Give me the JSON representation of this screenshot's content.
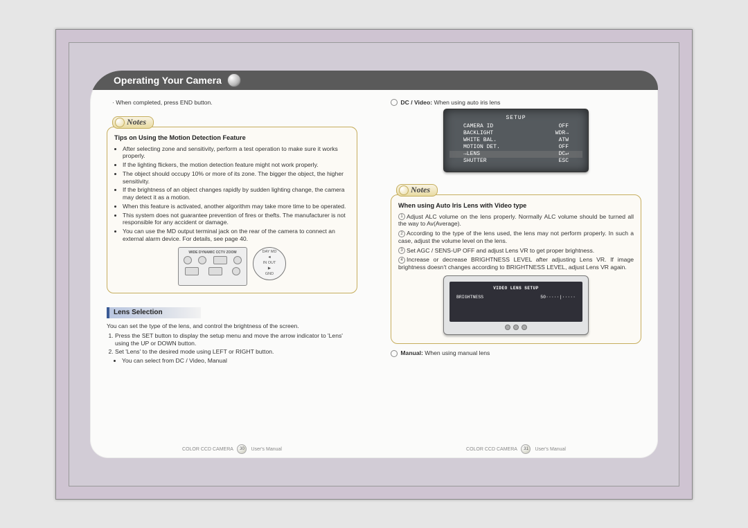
{
  "header": {
    "title": "Operating Your Camera"
  },
  "left": {
    "top_line": "· When completed, press END button.",
    "notes": {
      "label": "Notes",
      "title": "Tips on Using the Motion Detection Feature",
      "items": [
        "After selecting zone and sensitivity, perform a test operation to make sure it works properly.",
        "If the lighting flickers, the motion detection feature might not work properly.",
        "The object should occupy 10% or more of its zone. The bigger the object, the higher sensitivity.",
        "If the brightness of an object changes rapidly by sudden lighting change, the camera may detect it as a motion.",
        "When this feature is activated, another algorithm may take more time to be operated.",
        "This system does not guarantee prevention of fires or thefts. The manufacturer is not responsible for any accident or damage.",
        "You can use the MD output terminal jack on the rear of the camera to connect an external alarm device. For details, see page 40."
      ],
      "panel_title": "WIDE DYNAMIC CCTV ZOOM",
      "zoom_labels": {
        "l1": "DAY    MD",
        "l2": "◄",
        "l3": "IN   OUT",
        "l4": "▶",
        "l5": "GND"
      }
    },
    "section": {
      "heading": "Lens Selection",
      "intro": "You can set the type of the lens, and control the brightness of the screen.",
      "steps": [
        "Press the SET button to display the setup menu and move the arrow indicator to 'Lens' using the UP or DOWN button.",
        "Set 'Lens' to the desired mode using LEFT or RIGHT button."
      ],
      "substep": "You can select from DC / Video, Manual"
    },
    "footer": {
      "brand": "COLOR CCD CAMERA",
      "page": "30",
      "suffix": "User's Manual"
    }
  },
  "right": {
    "top_bullet": {
      "label": "DC / Video:",
      "text": " When using auto iris lens"
    },
    "osd": {
      "title": "SETUP",
      "rows": [
        {
          "k": "CAMERA ID",
          "v": "OFF"
        },
        {
          "k": "BACKLIGHT",
          "v": "WDR→"
        },
        {
          "k": "WHITE BAL.",
          "v": "ATW"
        },
        {
          "k": "MOTION DET.",
          "v": "OFF"
        },
        {
          "k": "→LENS",
          "v": "DC↵",
          "hl": true
        },
        {
          "k": "SHUTTER",
          "v": "ESC"
        }
      ]
    },
    "notes": {
      "label": "Notes",
      "title": "When using Auto Iris Lens with Video type",
      "items": [
        "Adjust ALC volume on the lens properly. Normally ALC volume should be turned all the way to Av(Average).",
        "According to the type of the lens used, the lens may not perform properly. In such a case, adjust the volume level on the lens.",
        "Set AGC / SENS-UP OFF and adjust Lens VR to get proper brightness.",
        "Increase or decrease BRIGHTNESS LEVEL after adjusting Lens VR. If image brightness doesn't changes according to BRIGHTNESS LEVEL, adjust Lens VR again."
      ],
      "monitor": {
        "title": "VIDEO LENS SETUP",
        "row_label": "BRIGHTNESS",
        "row_value": "50·····|·····"
      }
    },
    "bottom_bullet": {
      "label": "Manual:",
      "text": " When using manual lens"
    },
    "footer": {
      "brand": "COLOR CCD CAMERA",
      "page": "31",
      "suffix": "User's Manual"
    }
  }
}
